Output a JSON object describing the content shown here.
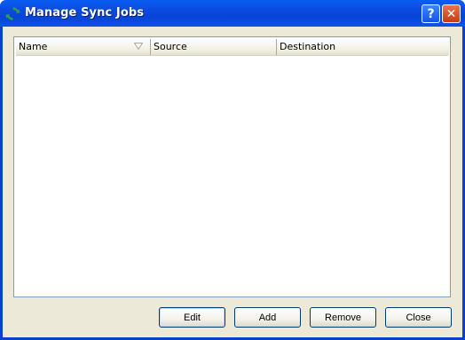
{
  "window": {
    "title": "Manage Sync Jobs"
  },
  "titlebar": {
    "help_label": "?",
    "close_label": "✕"
  },
  "table": {
    "columns": [
      "Name",
      "Source",
      "Destination"
    ],
    "sort_column": "Name",
    "rows": []
  },
  "buttons": {
    "edit": "Edit",
    "add": "Add",
    "remove": "Remove",
    "close": "Close"
  },
  "icons": {
    "app": "sync-icon",
    "sort": "sort-descending-icon"
  },
  "colors": {
    "titlebar": "#0a4ce0",
    "dialog_bg": "#ece9d8",
    "sync_icon": "#2fa043"
  }
}
